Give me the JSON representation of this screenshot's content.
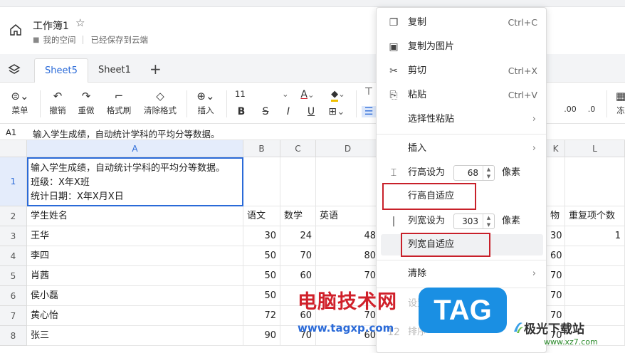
{
  "header": {
    "title": "工作簿1",
    "folder": "我的空间",
    "status": "已经保存到云端"
  },
  "sheets": [
    {
      "label": "Sheet5",
      "active": true
    },
    {
      "label": "Sheet1",
      "active": false
    }
  ],
  "toolbar": {
    "menu": "菜单",
    "undo": "撤销",
    "redo": "重做",
    "format_painter": "格式刷",
    "clear_format": "清除格式",
    "insert": "插入",
    "font_size": "11",
    "freeze": "冻"
  },
  "formula": {
    "cell_ref": "A1",
    "content": "输入学生成绩，自动统计学科的平均分等数据。"
  },
  "grid": {
    "columns": [
      "A",
      "B",
      "C",
      "D",
      "K",
      "L"
    ],
    "a1_lines": [
      "输入学生成绩，自动统计学科的平均分等数据。",
      "班级：X年X班",
      "统计日期：X年X月X日"
    ],
    "header_row": [
      "学生姓名",
      "语文",
      "数学",
      "英语",
      "物",
      "重复项个数"
    ],
    "rows": [
      {
        "num": "3",
        "name": "王华",
        "b": "30",
        "c": "24",
        "d": "48",
        "k": "30",
        "l": "1"
      },
      {
        "num": "4",
        "name": "李四",
        "b": "50",
        "c": "70",
        "d": "80",
        "k": "60",
        "l": ""
      },
      {
        "num": "5",
        "name": "肖茜",
        "b": "50",
        "c": "60",
        "d": "70",
        "k": "70",
        "l": ""
      },
      {
        "num": "6",
        "name": "侯小磊",
        "b": "50",
        "c": "",
        "d": "",
        "k": "70",
        "l": ""
      },
      {
        "num": "7",
        "name": "黄心怡",
        "b": "72",
        "c": "60",
        "d": "70",
        "k": "70",
        "l": ""
      },
      {
        "num": "8",
        "name": "张三",
        "b": "90",
        "c": "70",
        "d": "60",
        "k": "70",
        "l": ""
      }
    ],
    "row_nums": [
      "1",
      "2"
    ]
  },
  "context_menu": {
    "copy": "复制",
    "copy_sc": "Ctrl+C",
    "copy_as_image": "复制为图片",
    "cut": "剪切",
    "cut_sc": "Ctrl+X",
    "paste": "粘贴",
    "paste_sc": "Ctrl+V",
    "paste_special": "选择性粘贴",
    "insert": "插入",
    "row_height_label": "行高设为",
    "row_height_value": "68",
    "row_height_unit": "像素",
    "row_autofit": "行高自适应",
    "col_width_label": "列宽设为",
    "col_width_value": "303",
    "col_width_unit": "像素",
    "col_autofit": "列宽自适应",
    "clear": "清除",
    "cond_format": "设置单元格格式",
    "sort": "排序",
    "sort_num": "12"
  },
  "watermark": {
    "site_cn": "电脑技术网",
    "site_url": "www.tagxp.com",
    "tag": "TAG",
    "brand": "极光下载站",
    "brand_url": "www.xz7.com"
  },
  "colors": {
    "accent": "#2a6ad8",
    "highlight": "#c8202a"
  }
}
